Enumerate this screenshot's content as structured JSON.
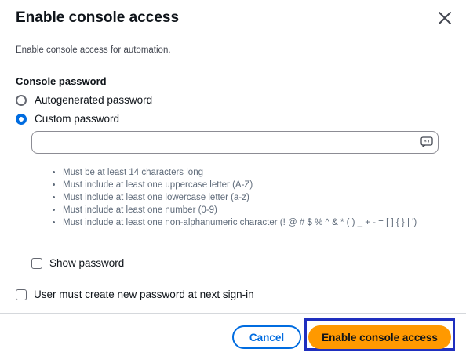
{
  "dialog": {
    "title": "Enable console access",
    "subtitle": "Enable console access for automation.",
    "close_icon": "close-icon"
  },
  "console_password": {
    "label": "Console password",
    "options": [
      {
        "label": "Autogenerated password",
        "selected": false
      },
      {
        "label": "Custom password",
        "selected": true
      }
    ],
    "input_value": "",
    "input_icon": "password-generate-icon",
    "rules": [
      "Must be at least 14 characters long",
      "Must include at least one uppercase letter (A-Z)",
      "Must include at least one lowercase letter (a-z)",
      "Must include at least one number (0-9)",
      "Must include at least one non-alphanumeric character (! @ # $ % ^ & * ( ) _ + - = [ ] { } | ')"
    ],
    "show_password_label": "Show password",
    "show_password_checked": false
  },
  "reset_required": {
    "label": "User must create new password at next sign-in",
    "checked": false
  },
  "footer": {
    "cancel_label": "Cancel",
    "primary_label": "Enable console access"
  },
  "colors": {
    "accent": "#006ce0",
    "primary_button": "#ff9900",
    "focus_ring": "#1f2fbf"
  }
}
